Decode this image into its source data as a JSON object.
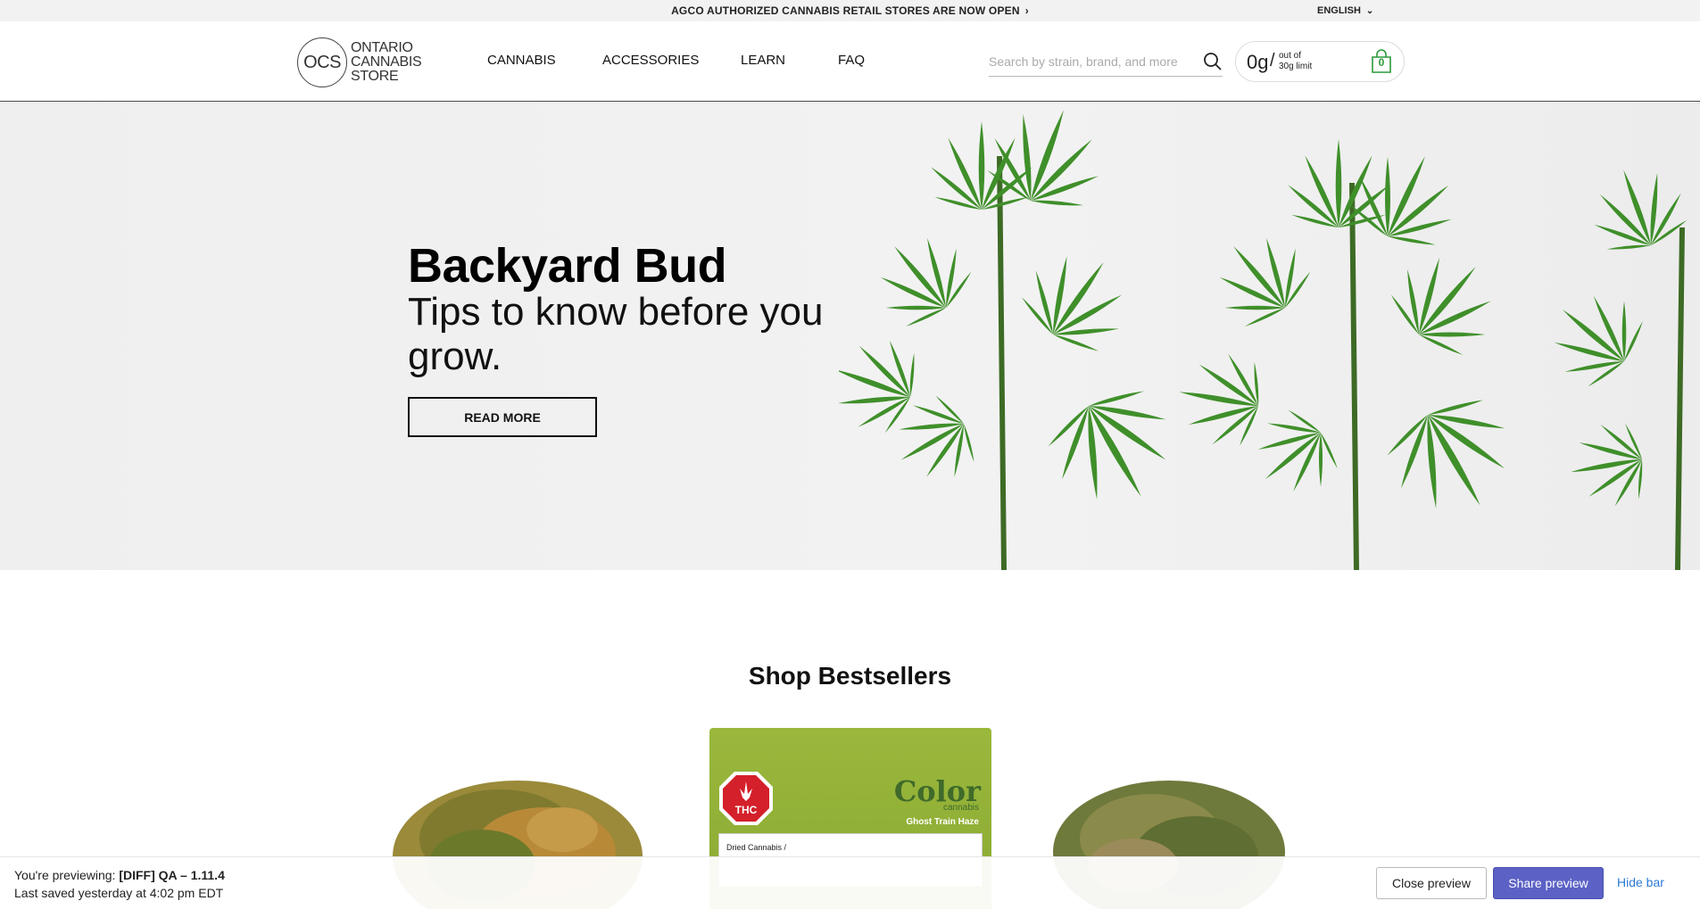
{
  "announcement": {
    "text": "AGCO AUTHORIZED CANNABIS RETAIL STORES ARE NOW OPEN",
    "language": "ENGLISH"
  },
  "logo": {
    "abbr": "OCS",
    "line1": "ONTARIO",
    "line2": "CANNABIS",
    "line3": "STORE"
  },
  "nav": [
    "CANNABIS",
    "ACCESSORIES",
    "LEARN",
    "FAQ"
  ],
  "search": {
    "placeholder": "Search by strain, brand, and more"
  },
  "limit": {
    "grams": "0g",
    "slash": "/",
    "out_of": "out of",
    "limit": "30g limit",
    "cart_count": "0"
  },
  "hero": {
    "title": "Backyard Bud",
    "subtitle": "Tips to know before you grow.",
    "button": "READ MORE"
  },
  "bestsellers": {
    "title": "Shop Bestsellers",
    "package": {
      "thc": "THC",
      "brand": "Color",
      "brand_sub": "cannabis",
      "strain": "Ghost Train Haze",
      "label": "Dried Cannabis /"
    }
  },
  "preview": {
    "previewing_label": "You're previewing:",
    "previewing_name": "[DIFF] QA – 1.11.4",
    "saved": "Last saved yesterday at 4:02 pm EDT",
    "close": "Close preview",
    "share": "Share preview",
    "hide": "Hide bar"
  },
  "colors": {
    "accent_green": "#2b9a3a",
    "share_button": "#5c62c5",
    "link_blue": "#2a7ad6"
  }
}
